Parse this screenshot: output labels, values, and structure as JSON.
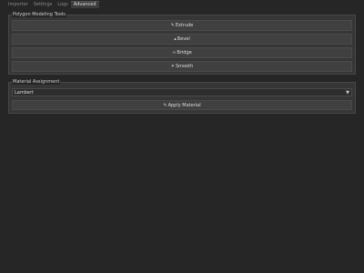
{
  "tabs": [
    {
      "label": "Importer"
    },
    {
      "label": "Settings"
    },
    {
      "label": "Logs"
    },
    {
      "label": "Advanced",
      "active": true
    }
  ],
  "polygon_tools": {
    "title": "Polygon Modeling Tools",
    "buttons": [
      {
        "label": "Extrude",
        "icon": "extrude-icon"
      },
      {
        "label": "Bevel",
        "icon": "bevel-icon"
      },
      {
        "label": "Bridge",
        "icon": "bridge-icon"
      },
      {
        "label": "Smooth",
        "icon": "smooth-icon"
      }
    ]
  },
  "material": {
    "title": "Material Assignment",
    "select_value": "Lambert",
    "apply_label": "Apply Material",
    "apply_icon": "brush-icon"
  }
}
